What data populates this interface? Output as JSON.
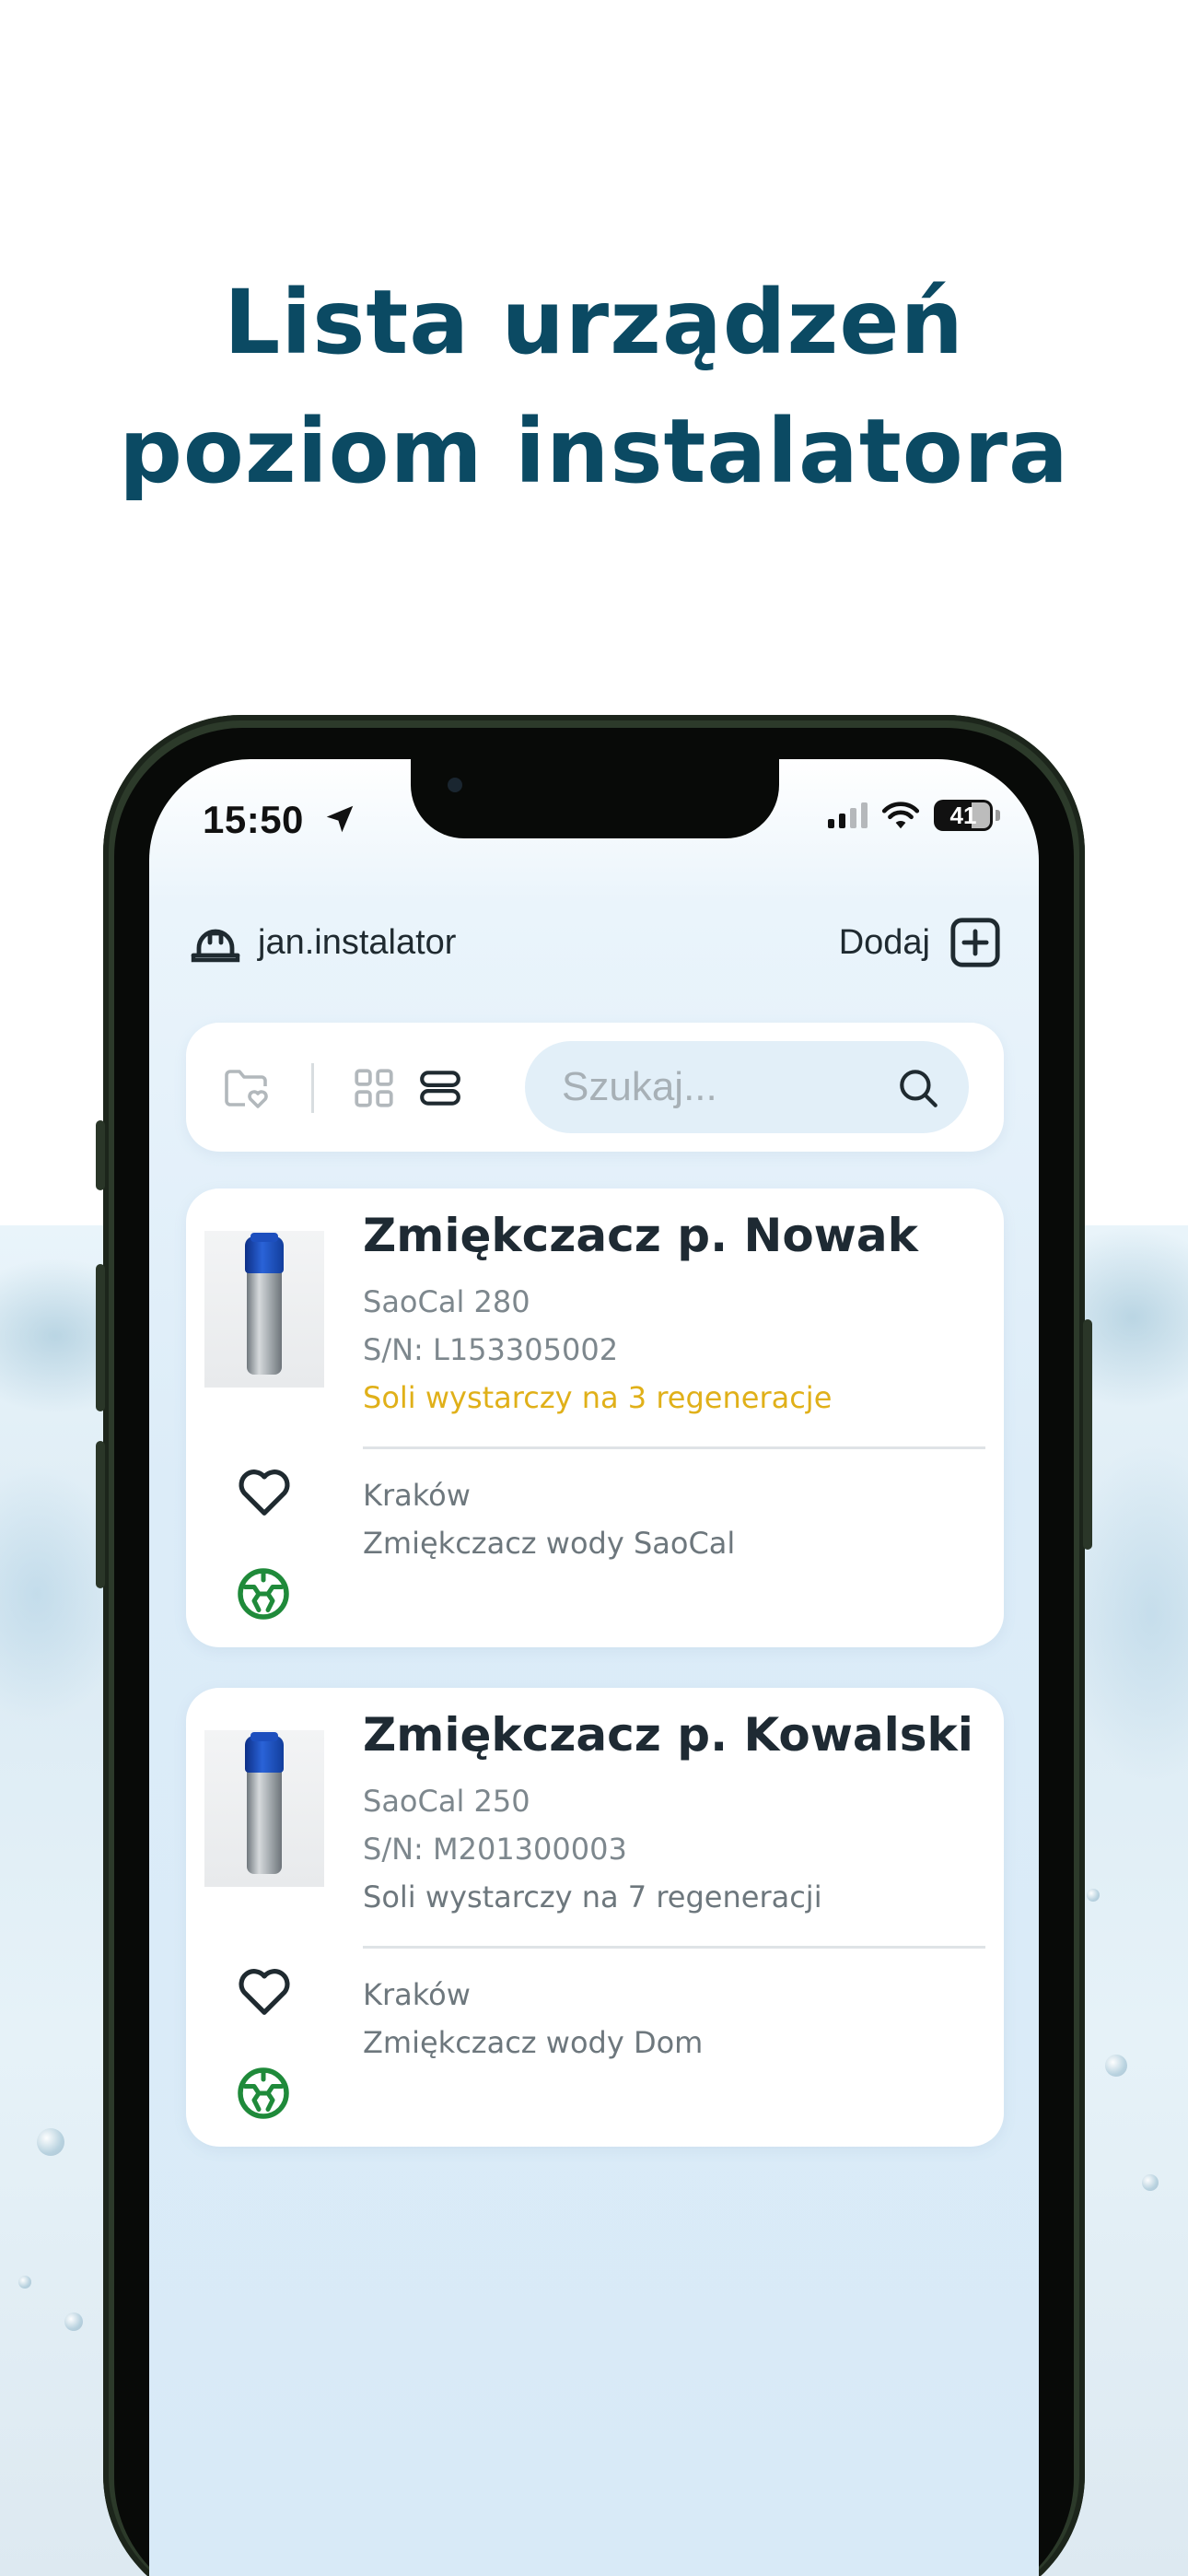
{
  "headline": {
    "line1": "Lista urządzeń",
    "line2": "poziom instalatora"
  },
  "status_bar": {
    "time": "15:50",
    "battery": "41"
  },
  "header": {
    "username": "jan.instalator",
    "add_label": "Dodaj"
  },
  "toolbar": {
    "search_placeholder": "Szukaj..."
  },
  "devices": [
    {
      "title": "Zmiękczacz p. Nowak",
      "model": "SaoCal 280",
      "serial": "S/N: L153305002",
      "salt_status": "Soli wystarczy na 3 regeneracje",
      "city": "Kraków",
      "description": "Zmiękczacz wody SaoCal"
    },
    {
      "title": "Zmiękczacz p. Kowalski",
      "model": "SaoCal 250",
      "serial": "S/N: M201300003",
      "salt_status": "Soli wystarczy na 7 regeneracji",
      "city": "Kraków",
      "description": "Zmiękczacz wody Dom"
    }
  ],
  "colors": {
    "headline": "#0b4a63",
    "accent_dark": "#1f2a30",
    "warning": "#e0b019",
    "eco_green": "#1f8a3a"
  },
  "icons": [
    "location-arrow-icon",
    "signal-icon",
    "wifi-icon",
    "battery-icon",
    "helmet-icon",
    "plus-square-icon",
    "folder-heart-icon",
    "grid-view-icon",
    "list-view-icon",
    "search-icon",
    "heart-icon",
    "eco-icon"
  ]
}
